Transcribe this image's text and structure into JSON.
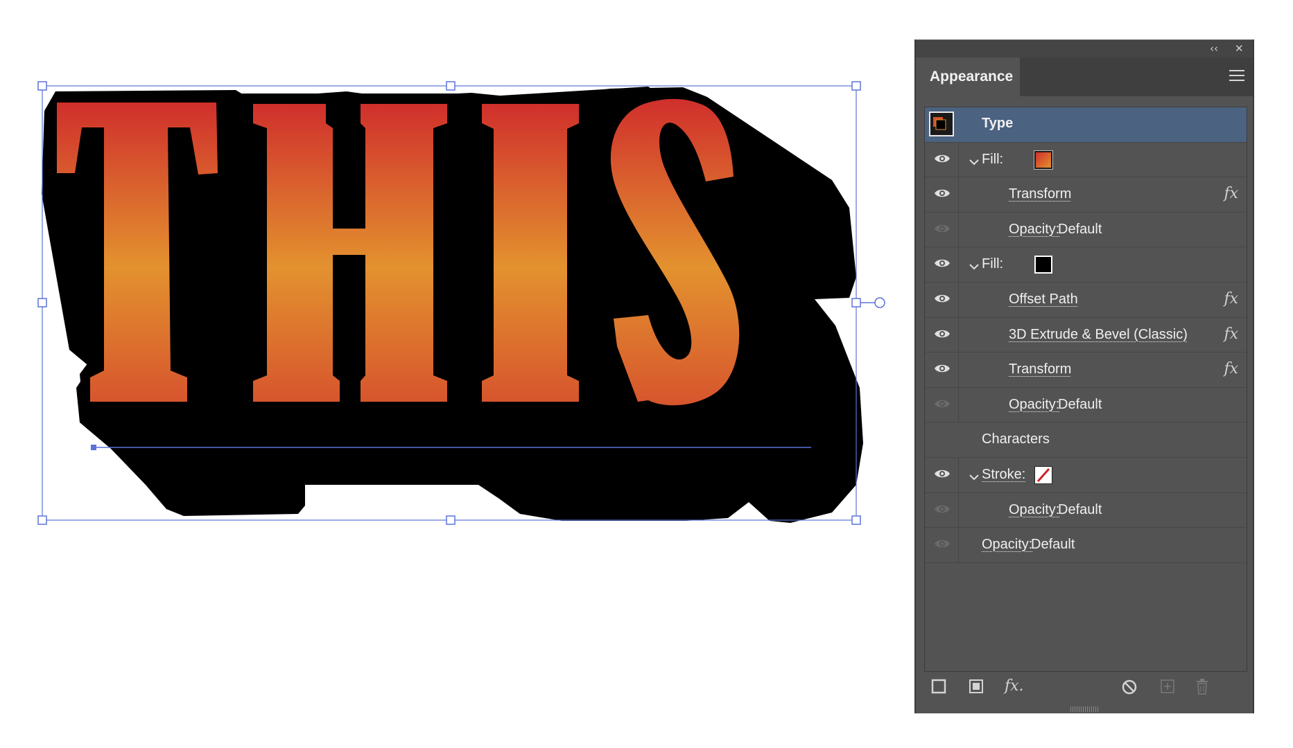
{
  "artwork": {
    "text": "THIS",
    "gradient": [
      "#d02f2c",
      "#e3922f",
      "#d7552d"
    ]
  },
  "panel": {
    "title": "Appearance",
    "collapse_glyph": "‹‹",
    "close_glyph": "✕",
    "rows": [
      {
        "kind": "type",
        "label": "Type"
      },
      {
        "kind": "fill",
        "label": "Fill:",
        "swatch": "gradient"
      },
      {
        "kind": "effect",
        "label": "Transform",
        "fx": "fx"
      },
      {
        "kind": "opacity",
        "label": "Opacity:",
        "value": "Default"
      },
      {
        "kind": "fill",
        "label": "Fill:",
        "swatch": "black"
      },
      {
        "kind": "effect",
        "label": "Offset Path",
        "fx": "fx"
      },
      {
        "kind": "effect",
        "label": "3D Extrude & Bevel (Classic)",
        "fx": "fx"
      },
      {
        "kind": "effect",
        "label": "Transform",
        "fx": "fx"
      },
      {
        "kind": "opacity",
        "label": "Opacity:",
        "value": "Default"
      },
      {
        "kind": "characters",
        "label": "Characters"
      },
      {
        "kind": "stroke",
        "label": "Stroke:",
        "swatch": "none"
      },
      {
        "kind": "opacity",
        "label": "Opacity:",
        "value": "Default"
      },
      {
        "kind": "top-opacity",
        "label": "Opacity:",
        "value": "Default"
      }
    ],
    "bottom_icons": [
      "new-stroke-icon",
      "new-fill-icon",
      "fx-menu-icon",
      "clear-appearance-icon",
      "duplicate-item-icon",
      "delete-item-icon"
    ],
    "fx_menu_glyph": "fx."
  }
}
